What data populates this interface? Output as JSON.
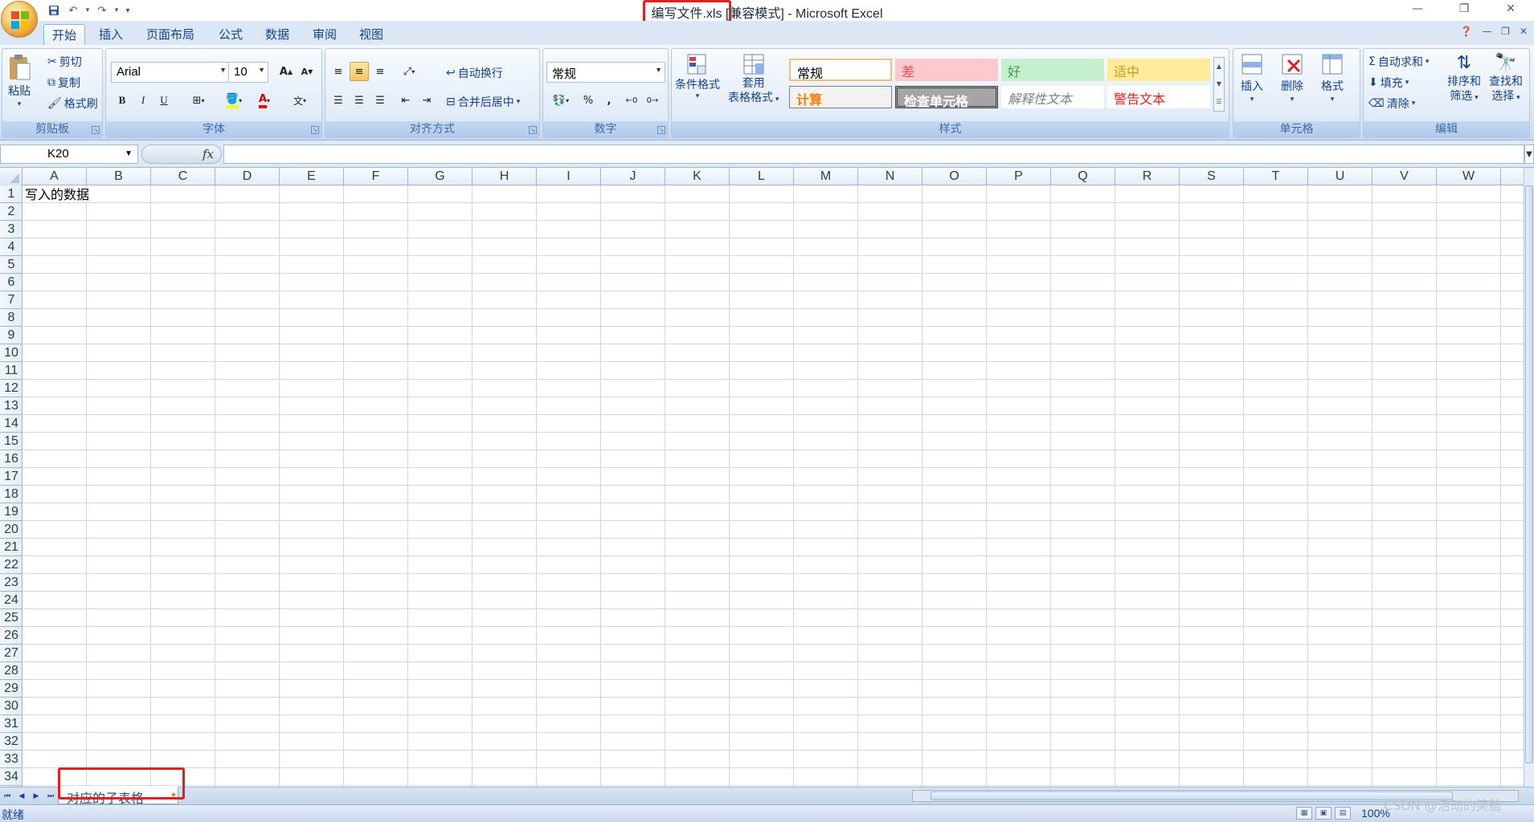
{
  "title": {
    "file_name": "编写文件.xls",
    "full": "编写文件.xls  [兼容模式] - Microsoft Excel"
  },
  "tabs": [
    "开始",
    "插入",
    "页面布局",
    "公式",
    "数据",
    "审阅",
    "视图"
  ],
  "clipboard": {
    "paste": "粘贴",
    "cut": "剪切",
    "copy": "复制",
    "format_painter": "格式刷",
    "label": "剪贴板"
  },
  "font": {
    "name": "Arial",
    "size": "10",
    "bold": "B",
    "italic": "I",
    "underline": "U",
    "label": "字体"
  },
  "alignment": {
    "wrap_text": "自动换行",
    "merge_center": "合并后居中",
    "label": "对齐方式"
  },
  "number": {
    "format": "常规",
    "percent": "%",
    "comma": ",",
    "label": "数字"
  },
  "styles": {
    "conditional": "条件格式",
    "table_format_1": "套用",
    "table_format_2": "表格格式",
    "cells": {
      "normal": "常规",
      "bad": "差",
      "good": "好",
      "neutral": "适中",
      "calculation": "计算",
      "check_cell": "检查单元格",
      "explanatory": "解释性文本",
      "warning": "警告文本"
    },
    "label": "样式"
  },
  "cells_group": {
    "insert": "插入",
    "delete": "删除",
    "format": "格式",
    "label": "单元格"
  },
  "editing": {
    "autosum": "自动求和",
    "fill": "填充",
    "clear": "清除",
    "sort_filter_1": "排序和",
    "sort_filter_2": "筛选",
    "find_select_1": "查找和",
    "find_select_2": "选择",
    "label": "编辑"
  },
  "formula_bar": {
    "name_box": "K20",
    "fx": "fx",
    "value": ""
  },
  "sheet": {
    "columns": [
      "A",
      "B",
      "C",
      "D",
      "E",
      "F",
      "G",
      "H",
      "I",
      "J",
      "K",
      "L",
      "M",
      "N",
      "O",
      "P",
      "Q",
      "R",
      "S",
      "T",
      "U",
      "V",
      "W"
    ],
    "rows": [
      "1",
      "2",
      "3",
      "4",
      "5",
      "6",
      "7",
      "8",
      "9",
      "10",
      "11",
      "12",
      "13",
      "14",
      "15",
      "16",
      "17",
      "18",
      "19",
      "20",
      "21",
      "22",
      "23",
      "24",
      "25",
      "26",
      "27",
      "28",
      "29",
      "30",
      "31",
      "32",
      "33",
      "34"
    ],
    "cell_a1": "写入的数据"
  },
  "sheet_tabs": [
    "对应的子表格"
  ],
  "status": {
    "text": "就绪",
    "zoom": "100%"
  },
  "watermark": "CSDN @活动的笑脸"
}
